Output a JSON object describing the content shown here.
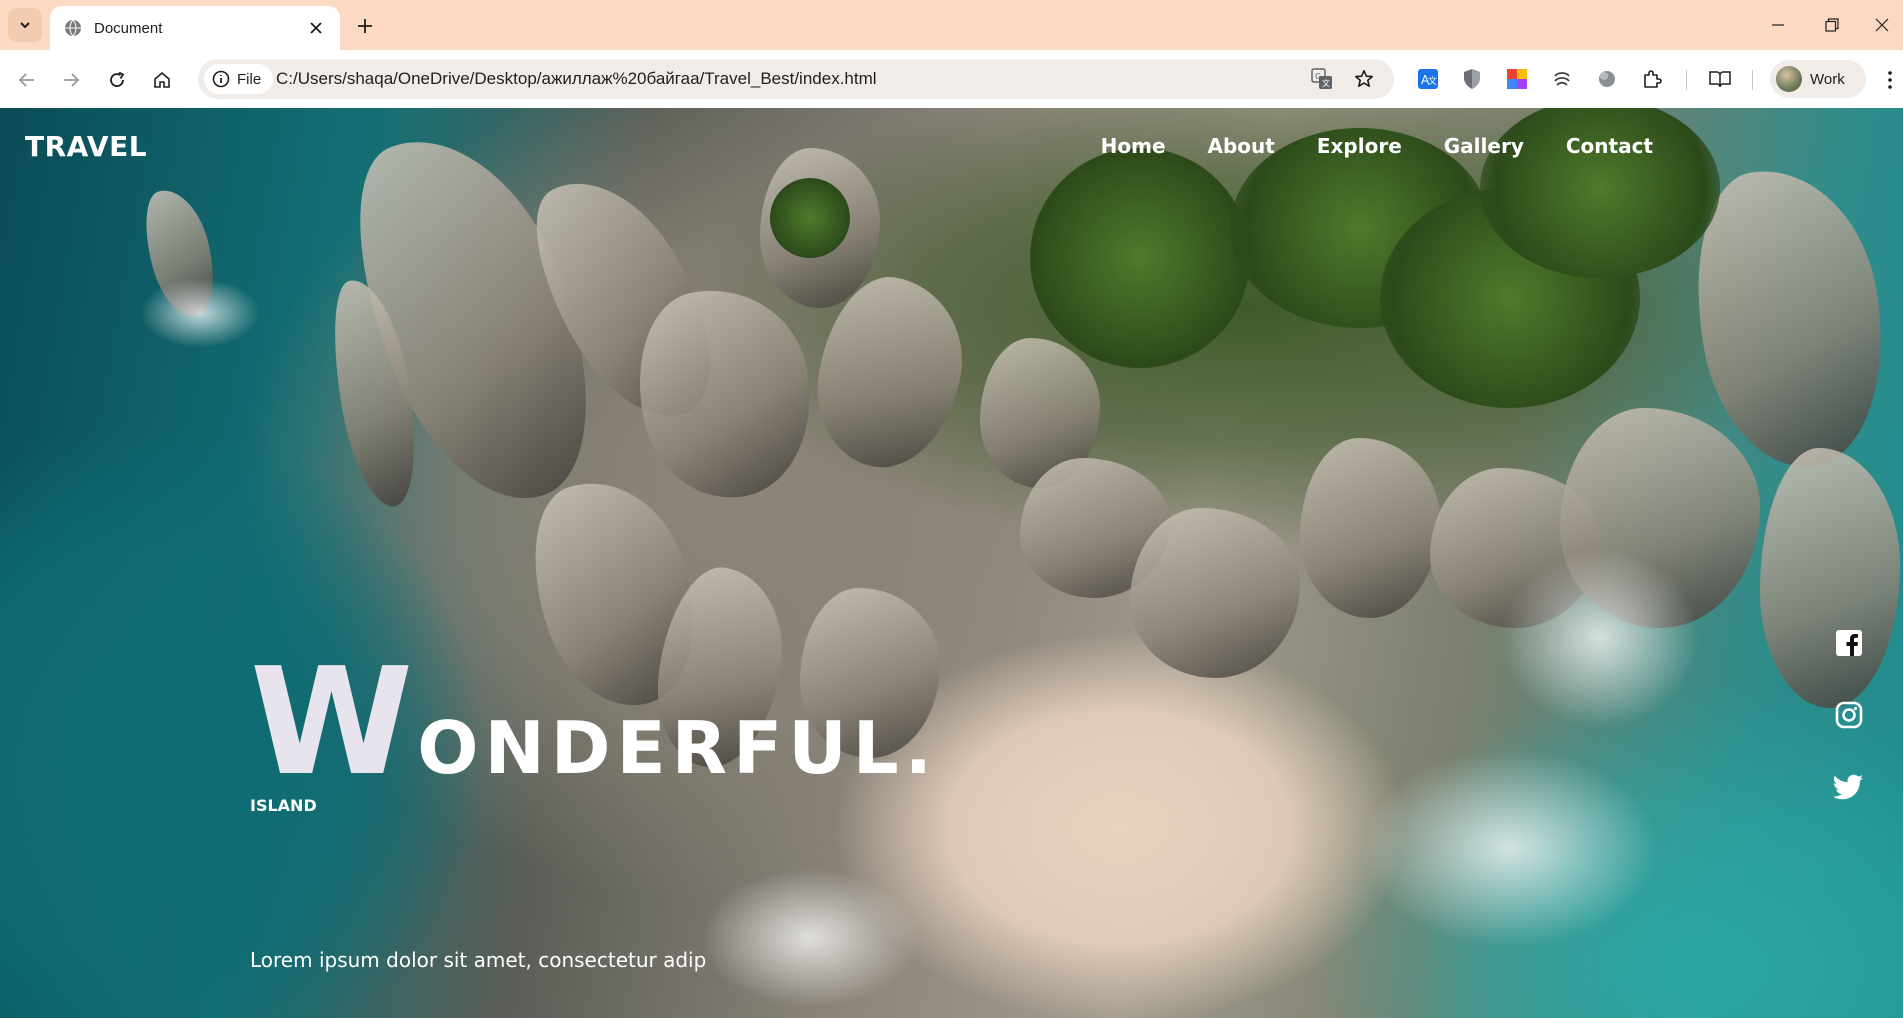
{
  "browser": {
    "tab_title": "Document",
    "chip_label": "File",
    "url": "C:/Users/shaqa/OneDrive/Desktop/ажиллаж%20байгаа/Travel_Best/index.html",
    "profile_label": "Work"
  },
  "site": {
    "logo": "TRAVEL",
    "nav": [
      "Home",
      "About",
      "Explore",
      "Gallery",
      "Contact"
    ],
    "hero": {
      "first_letter": "W",
      "line1_rest": "ONDERFUL.",
      "line2": "ISLAND",
      "subtitle": "Lorem ipsum dolor sit amet, consectetur adip"
    },
    "social": [
      "facebook-icon",
      "instagram-icon",
      "twitter-icon"
    ]
  },
  "colors": {
    "tabstrip": "#fbd9c2",
    "hero_text": "#ffffff",
    "hero_big_letter": "#e8e4ee"
  }
}
